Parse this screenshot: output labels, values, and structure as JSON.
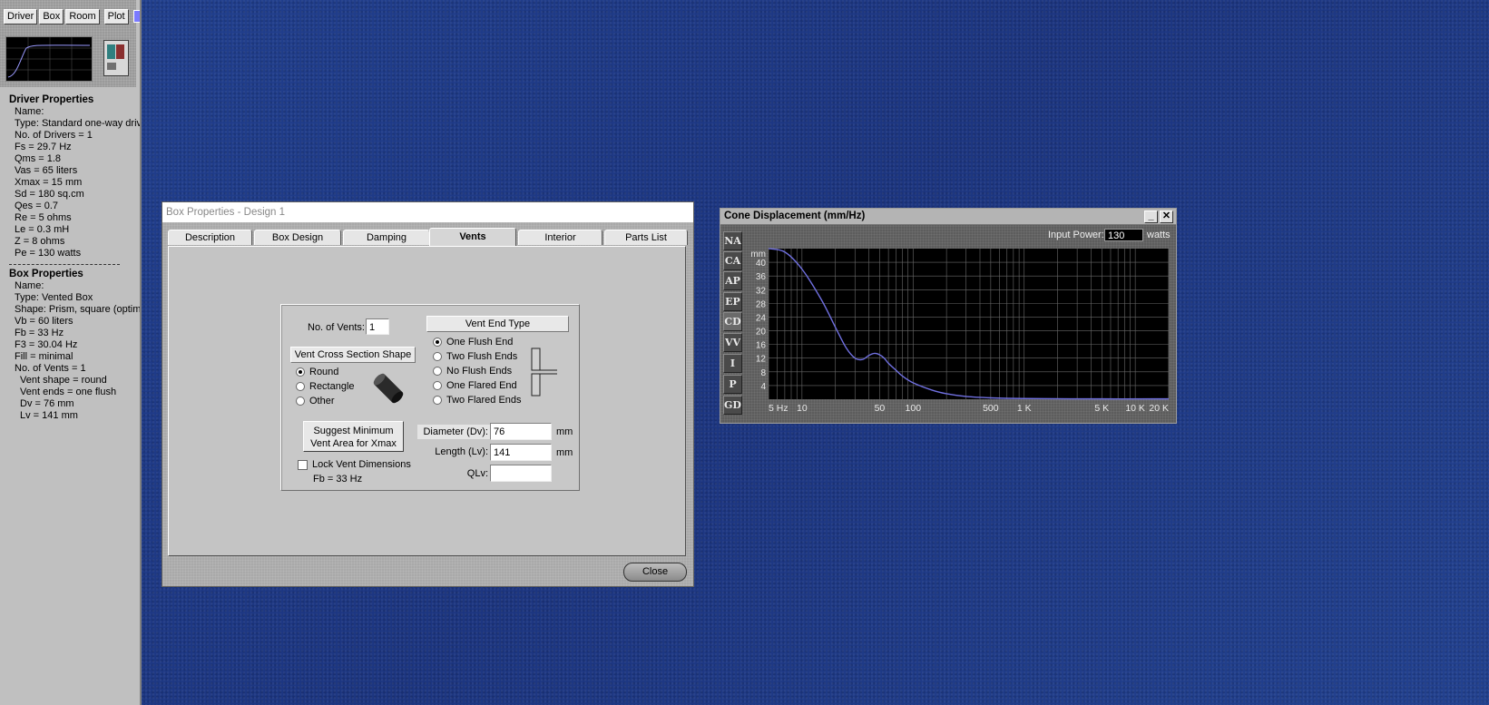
{
  "left_panel": {
    "tabs": [
      "Driver",
      "Box",
      "Room",
      "Plot"
    ],
    "accent_swatch": "#7a7aff",
    "driver": {
      "title": "Driver Properties",
      "lines": [
        "Name:",
        "Type: Standard one-way driv",
        "No. of Drivers = 1",
        "Fs =  29.7 Hz",
        "Qms =  1.8",
        "Vas =  65 liters",
        "Xmax =  15 mm",
        "Sd =  180 sq.cm",
        "Qes =  0.7",
        "Re =  5 ohms",
        "Le =  0.3 mH",
        "Z =  8 ohms",
        "Pe = 130 watts"
      ]
    },
    "box": {
      "title": "Box Properties",
      "lines": [
        "Name:",
        "Type: Vented Box",
        "Shape: Prism, square (optimu",
        "Vb =  60 liters",
        "Fb =  33 Hz",
        "F3 =  30.04 Hz",
        "Fill = minimal",
        "No. of Vents = 1"
      ],
      "sub_lines": [
        "Vent shape = round",
        "Vent ends = one flush",
        "Dv =  76 mm",
        "Lv =  141 mm"
      ]
    }
  },
  "box_window": {
    "title": "Box Properties - Design 1",
    "tabs": [
      "Description",
      "Box Design",
      "Damping",
      "Vents",
      "Interior",
      "Parts List"
    ],
    "active_tab": "Vents",
    "vents": {
      "num_label": "No. of Vents:",
      "num_value": "1",
      "shape_header": "Vent Cross Section Shape",
      "shape_options": [
        "Round",
        "Rectangle",
        "Other"
      ],
      "shape_selected": "Round",
      "end_header": "Vent End Type",
      "end_options": [
        "One Flush End",
        "Two Flush Ends",
        "No Flush Ends",
        "One Flared End",
        "Two Flared Ends"
      ],
      "end_selected": "One Flush End",
      "suggest_line1": "Suggest Minimum",
      "suggest_line2": "Vent Area for Xmax",
      "lock_label": "Lock Vent Dimensions",
      "fb_text": "Fb = 33 Hz",
      "diameter_label": "Diameter (Dv):",
      "diameter_value": "76",
      "diameter_unit": "mm",
      "length_label": "Length (Lv):",
      "length_value": "141",
      "length_unit": "mm",
      "qlv_label": "QLv:",
      "qlv_value": ""
    },
    "close_label": "Close"
  },
  "cone_window": {
    "title": "Cone Displacement (mm/Hz)",
    "minimize": "_",
    "close": "✕",
    "side_buttons": [
      "NA",
      "CA",
      "AP",
      "EP",
      "CD",
      "VV",
      "I",
      "P",
      "GD"
    ],
    "input_power_label": "Input Power:",
    "input_power_value": "130",
    "input_power_unit": "watts"
  },
  "chart_data": {
    "type": "line",
    "title": "Cone Displacement (mm/Hz)",
    "xlabel": "",
    "ylabel": "mm",
    "x_scale": "log",
    "xlim": [
      5,
      20000
    ],
    "ylim": [
      0,
      44
    ],
    "x_ticks": [
      {
        "value": 5,
        "label": "5 Hz"
      },
      {
        "value": 10,
        "label": "10"
      },
      {
        "value": 50,
        "label": "50"
      },
      {
        "value": 100,
        "label": "100"
      },
      {
        "value": 500,
        "label": "500"
      },
      {
        "value": 1000,
        "label": "1 K"
      },
      {
        "value": 5000,
        "label": "5 K"
      },
      {
        "value": 10000,
        "label": "10 K"
      },
      {
        "value": 20000,
        "label": "20 K"
      }
    ],
    "y_ticks": [
      4,
      8,
      12,
      16,
      20,
      24,
      28,
      32,
      36,
      40
    ],
    "grid": true,
    "colors": {
      "background": "#000000",
      "grid": "#6a6a6a",
      "line": "#7070e0"
    },
    "series": [
      {
        "x": [
          5,
          7,
          10,
          15,
          20,
          25,
          30,
          35,
          40,
          45,
          50,
          55,
          60,
          70,
          80,
          100,
          150,
          200,
          300,
          500,
          1000,
          5000,
          20000
        ],
        "y": [
          44,
          43,
          38,
          29,
          21,
          15,
          12,
          11.6,
          12.8,
          13.4,
          13,
          12,
          10.5,
          8.5,
          6.8,
          4.8,
          2.6,
          1.6,
          0.8,
          0.4,
          0.2,
          0.1,
          0.1
        ]
      }
    ]
  }
}
